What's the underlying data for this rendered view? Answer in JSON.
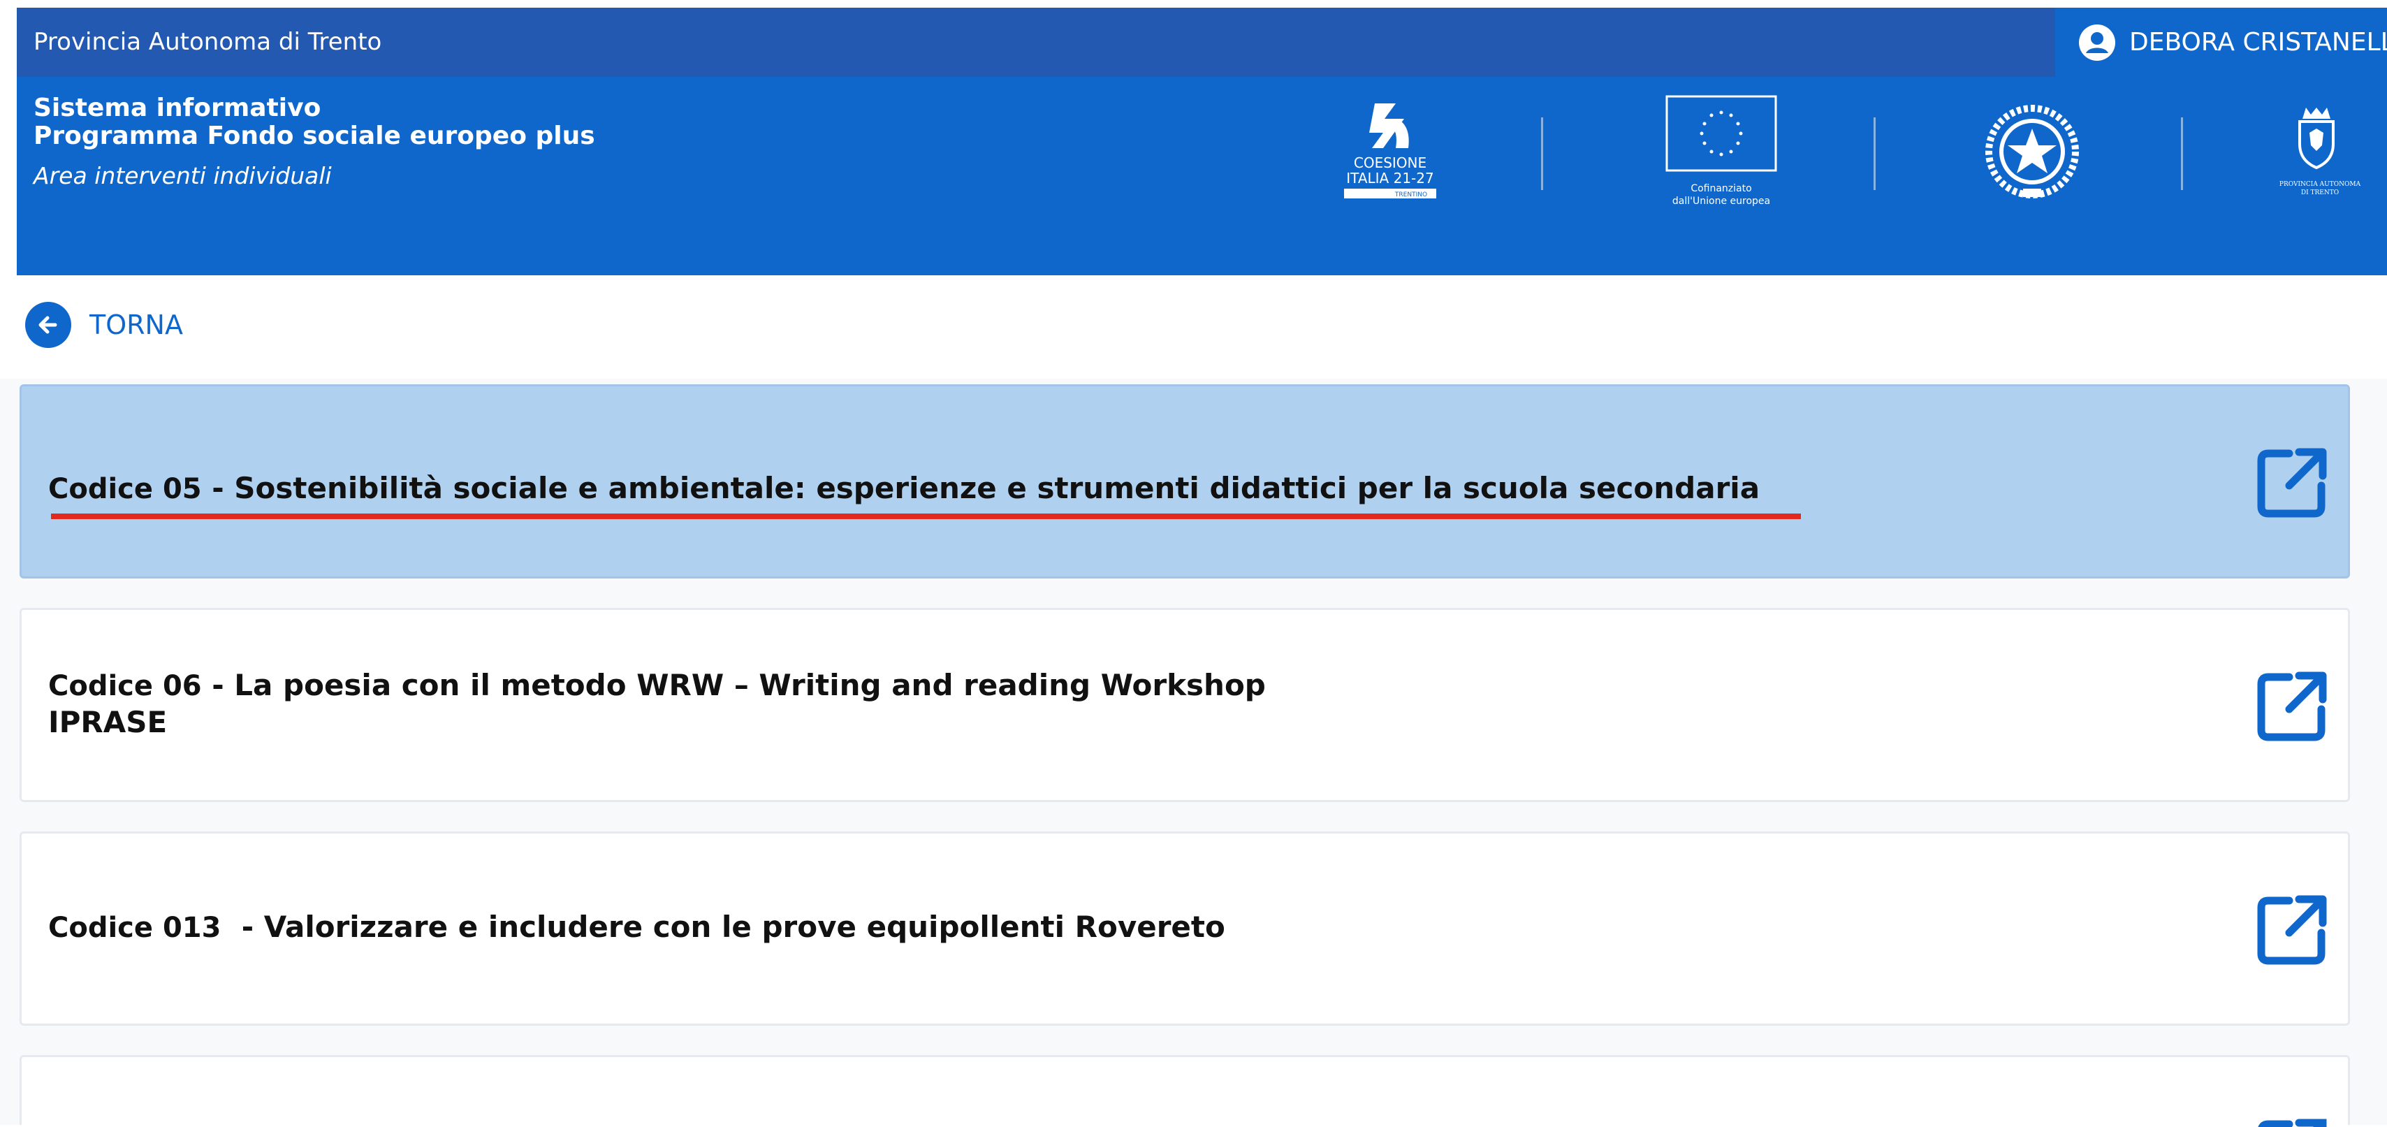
{
  "topbar": {
    "org": "Provincia Autonoma di Trento",
    "user": "DEBORA CRISTANELLI"
  },
  "header": {
    "title_line1": "Sistema informativo",
    "title_line2": "Programma Fondo sociale europeo plus",
    "subtitle": "Area interventi individuali",
    "logos": {
      "coesione_line1": "COESIONE",
      "coesione_line2": "ITALIA 21-27",
      "coesione_tag": "TRENTINO",
      "eu_line1": "Cofinanziato",
      "eu_line2": "dall'Unione europea",
      "pat_line1": "PROVINCIA AUTONOMA",
      "pat_line2": "DI TRENTO"
    }
  },
  "nav": {
    "back_label": "TORNA"
  },
  "courses": [
    {
      "code": "Codice 05",
      "separator": " - ",
      "title": "Sostenibilità sociale e ambientale: esperienze e strumenti didattici per la scuola secondaria",
      "line2": ""
    },
    {
      "code": "Codice 06",
      "separator": " - ",
      "title": "La poesia con il metodo WRW – Writing and reading Workshop",
      "line2": "IPRASE"
    },
    {
      "code": "Codice 013",
      "separator": "  - ",
      "title": "Valorizzare e includere con le prove equipollenti Rovereto",
      "line2": ""
    }
  ],
  "colors": {
    "brand_blue": "#0f67cb",
    "topbar_blue": "#2459b1",
    "active_card": "#b0d0ef",
    "underline_red": "#e3281d"
  }
}
